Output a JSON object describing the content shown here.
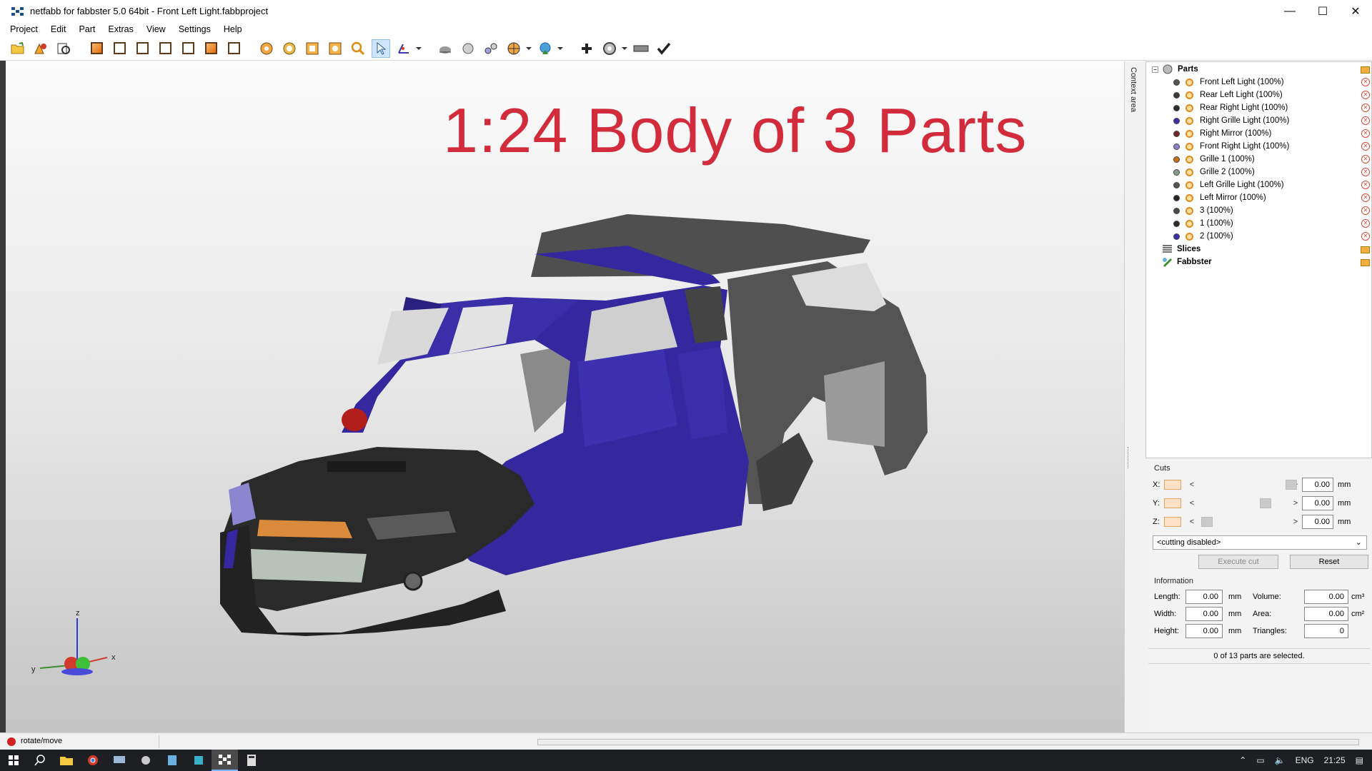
{
  "window": {
    "title": "netfabb for fabbster 5.0 64bit - Front Left Light.fabbproject",
    "controls": [
      "—",
      "☐",
      "✕"
    ]
  },
  "menu": [
    "Project",
    "Edit",
    "Part",
    "Extras",
    "View",
    "Settings",
    "Help"
  ],
  "viewport": {
    "overlay_title": "1:24 Body of 3 Parts",
    "axis": {
      "x": "x",
      "y": "y",
      "z": "z"
    },
    "colors": {
      "title": "#d22b3c",
      "blue_part": "#3a2fa6",
      "dark_part": "#2b2b2b",
      "grey_part": "#5a5a5a",
      "grille": "#d9843a",
      "mirror": "#b8231b"
    }
  },
  "context_tab": "Context area",
  "tree": {
    "root": "Parts",
    "parts": [
      {
        "label": "Front Left Light (100%)",
        "color": "#555555"
      },
      {
        "label": "Rear Left Light (100%)",
        "color": "#3b3b3b"
      },
      {
        "label": "Rear Right Light (100%)",
        "color": "#2c2c2c"
      },
      {
        "label": "Right Grille Light (100%)",
        "color": "#3a2fa6"
      },
      {
        "label": "Right Mirror (100%)",
        "color": "#6e2a2a"
      },
      {
        "label": "Front Right Light (100%)",
        "color": "#8a82c9"
      },
      {
        "label": "Grille 1 (100%)",
        "color": "#c9711a"
      },
      {
        "label": "Grille 2 (100%)",
        "color": "#8a9c8c"
      },
      {
        "label": "Left Grille Light (100%)",
        "color": "#555555"
      },
      {
        "label": "Left Mirror (100%)",
        "color": "#262626"
      },
      {
        "label": "3 (100%)",
        "color": "#4a4a4a"
      },
      {
        "label": "1 (100%)",
        "color": "#2c2c2c"
      },
      {
        "label": "2 (100%)",
        "color": "#3a2fa6"
      }
    ],
    "other_roots": [
      "Slices",
      "Fabbster"
    ]
  },
  "cuts": {
    "title": "Cuts",
    "rows": [
      {
        "axis": "X:",
        "value": "0.00",
        "unit": "mm"
      },
      {
        "axis": "Y:",
        "value": "0.00",
        "unit": "mm"
      },
      {
        "axis": "Z:",
        "value": "0.00",
        "unit": "mm"
      }
    ],
    "mode": "<cutting disabled>",
    "execute_label": "Execute cut",
    "reset_label": "Reset"
  },
  "information": {
    "title": "Information",
    "length_label": "Length:",
    "length": "0.00",
    "length_unit": "mm",
    "width_label": "Width:",
    "width": "0.00",
    "width_unit": "mm",
    "height_label": "Height:",
    "height": "0.00",
    "height_unit": "mm",
    "volume_label": "Volume:",
    "volume": "0.00",
    "volume_unit": "cm³",
    "area_label": "Area:",
    "area": "0.00",
    "area_unit": "cm²",
    "triangles_label": "Triangles:",
    "triangles": "0",
    "selection_status": "0 of 13 parts are selected."
  },
  "statusbar": {
    "message": "rotate/move"
  },
  "taskbar": {
    "language": "ENG",
    "time": "21:25"
  }
}
